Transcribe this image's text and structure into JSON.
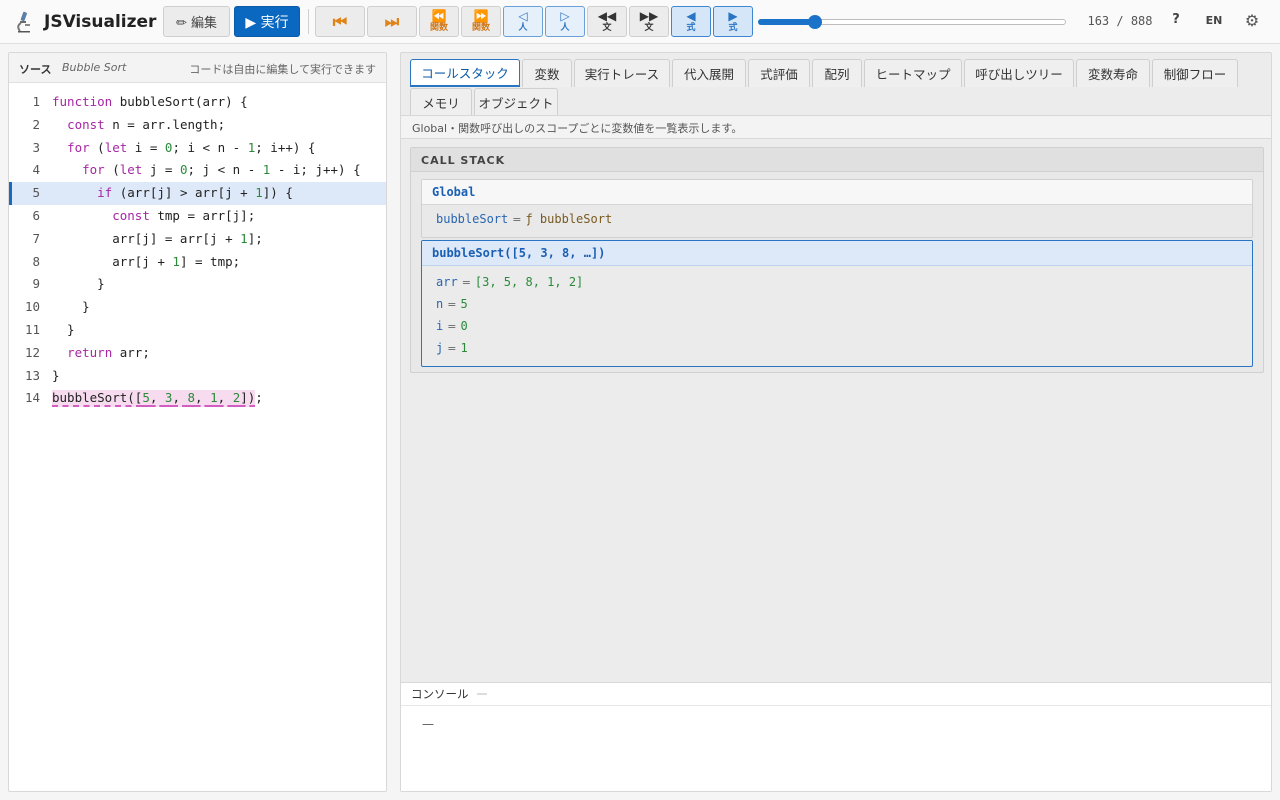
{
  "app": {
    "title": "JSVisualizer",
    "logo_icon": "microscope-icon"
  },
  "toolbar": {
    "edit_label": "✏ 編集",
    "run_label": "▶ 実行",
    "controls": [
      {
        "glyph": "⏮",
        "sub": "",
        "icon": "jump-start-icon"
      },
      {
        "glyph": "⏭",
        "sub": "",
        "icon": "jump-end-icon"
      },
      {
        "glyph": "⏪",
        "sub": "関数",
        "icon": "prev-function-icon"
      },
      {
        "glyph": "⏩",
        "sub": "関数",
        "icon": "next-function-icon"
      },
      {
        "glyph": "◁",
        "sub": "人",
        "icon": "step-back-human-icon"
      },
      {
        "glyph": "▷",
        "sub": "人",
        "icon": "step-forward-human-icon"
      },
      {
        "glyph": "◀◀",
        "sub": "文",
        "icon": "prev-statement-icon"
      },
      {
        "glyph": "▶▶",
        "sub": "文",
        "icon": "next-statement-icon"
      },
      {
        "glyph": "◀",
        "sub": "式",
        "icon": "prev-expression-icon"
      },
      {
        "glyph": "▶",
        "sub": "式",
        "icon": "next-expression-icon"
      }
    ],
    "step_current": 163,
    "step_total": 888,
    "step_counter": "163 / 888",
    "help_label": "?",
    "lang_label": "EN",
    "settings_icon": "gear-icon",
    "accent_color": "#0a68c0"
  },
  "source": {
    "title": "ソース",
    "name": "Bubble Sort",
    "hint": "コードは自由に編集して実行できます",
    "current_line": 5,
    "lines": [
      {
        "n": "1",
        "tokens": [
          [
            "kw",
            "function"
          ],
          [
            "t",
            " bubbleSort(arr) {"
          ]
        ]
      },
      {
        "n": "2",
        "tokens": [
          [
            "t",
            "  "
          ],
          [
            "kw",
            "const"
          ],
          [
            "t",
            " n = arr.length;"
          ]
        ]
      },
      {
        "n": "3",
        "tokens": [
          [
            "t",
            "  "
          ],
          [
            "kw",
            "for"
          ],
          [
            "t",
            " ("
          ],
          [
            "kw",
            "let"
          ],
          [
            "t",
            " i = "
          ],
          [
            "num",
            "0"
          ],
          [
            "t",
            "; i < n - "
          ],
          [
            "num",
            "1"
          ],
          [
            "t",
            "; i++) {"
          ]
        ]
      },
      {
        "n": "4",
        "tokens": [
          [
            "t",
            "    "
          ],
          [
            "kw",
            "for"
          ],
          [
            "t",
            " ("
          ],
          [
            "kw",
            "let"
          ],
          [
            "t",
            " j = "
          ],
          [
            "num",
            "0"
          ],
          [
            "t",
            "; j < n - "
          ],
          [
            "num",
            "1"
          ],
          [
            "t",
            " - i; j++) {"
          ]
        ]
      },
      {
        "n": "5",
        "tokens": [
          [
            "t",
            "      "
          ],
          [
            "kw",
            "if"
          ],
          [
            "t",
            " (arr[j] > arr[j + "
          ],
          [
            "num",
            "1"
          ],
          [
            "t",
            "]) {"
          ]
        ]
      },
      {
        "n": "6",
        "tokens": [
          [
            "t",
            "        "
          ],
          [
            "kw",
            "const"
          ],
          [
            "t",
            " tmp = arr[j];"
          ]
        ]
      },
      {
        "n": "7",
        "tokens": [
          [
            "t",
            "        arr[j] = arr[j + "
          ],
          [
            "num",
            "1"
          ],
          [
            "t",
            "];"
          ]
        ]
      },
      {
        "n": "8",
        "tokens": [
          [
            "t",
            "        arr[j + "
          ],
          [
            "num",
            "1"
          ],
          [
            "t",
            "] = tmp;"
          ]
        ]
      },
      {
        "n": "9",
        "tokens": [
          [
            "t",
            "      }"
          ]
        ]
      },
      {
        "n": "10",
        "tokens": [
          [
            "t",
            "    }"
          ]
        ]
      },
      {
        "n": "11",
        "tokens": [
          [
            "t",
            "  }"
          ]
        ]
      },
      {
        "n": "12",
        "tokens": [
          [
            "t",
            "  "
          ],
          [
            "kw",
            "return"
          ],
          [
            "t",
            " arr;"
          ]
        ]
      },
      {
        "n": "13",
        "tokens": [
          [
            "t",
            "}"
          ]
        ]
      },
      {
        "n": "14",
        "tokens": [
          [
            "call",
            "bubbleSort(["
          ],
          [
            "num",
            "5"
          ],
          [
            "call",
            ", "
          ],
          [
            "num",
            "3"
          ],
          [
            "call",
            ", "
          ],
          [
            "num",
            "8"
          ],
          [
            "call",
            ", "
          ],
          [
            "num",
            "1"
          ],
          [
            "call",
            ", "
          ],
          [
            "num",
            "2"
          ],
          [
            "call",
            "])"
          ],
          [
            "t",
            ";"
          ]
        ]
      }
    ]
  },
  "tabs": [
    {
      "label": "コールスタック",
      "active": true
    },
    {
      "label": "変数"
    },
    {
      "label": "実行トレース"
    },
    {
      "label": "代入展開"
    },
    {
      "label": "式評価"
    },
    {
      "label": "配列"
    },
    {
      "label": "ヒートマップ"
    },
    {
      "label": "呼び出しツリー"
    },
    {
      "label": "変数寿命"
    },
    {
      "label": "制御フロー"
    },
    {
      "label": "メモリ"
    },
    {
      "label": "オブジェクト"
    }
  ],
  "description": "Global・関数呼び出しのスコープごとに変数値を一覧表示します。",
  "callstack": {
    "title": "CALL STACK",
    "frames": [
      {
        "name": "Global",
        "active": false,
        "vars": [
          {
            "name": "bubbleSort",
            "value": "ƒ bubbleSort",
            "kind": "fn"
          }
        ]
      },
      {
        "name": "bubbleSort([5, 3, 8, …])",
        "active": true,
        "vars": [
          {
            "name": "arr",
            "value": "[3, 5, 8, 1, 2]",
            "kind": "num"
          },
          {
            "name": "n",
            "value": "5",
            "kind": "num"
          },
          {
            "name": "i",
            "value": "0",
            "kind": "num"
          },
          {
            "name": "j",
            "value": "1",
            "kind": "num"
          }
        ]
      }
    ]
  },
  "console": {
    "title": "コンソール",
    "output": "—"
  }
}
